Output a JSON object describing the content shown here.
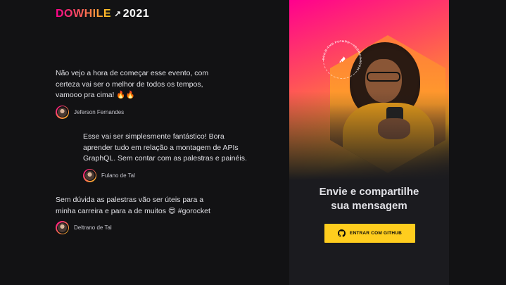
{
  "logo": {
    "do": "DOWHILE",
    "rocket": "↗",
    "year": "2021"
  },
  "messages": [
    {
      "text": "Não vejo a hora de começar esse evento, com certeza vai ser o melhor de todos os tempos, vamooo pra cima! 🔥🔥",
      "user": "Jeferson Fernandes"
    },
    {
      "text": "Esse vai ser simplesmente fantástico! Bora aprender tudo em relação a montagem de APIs GraphQL. Sem contar com as palestras e painéis.",
      "user": "Fulano de Tal"
    },
    {
      "text": "Sem dúvida as palestras vão ser úteis para a minha carreira e para a de muitos 😍 #gorocket",
      "user": "Deltrano de Tal"
    }
  ],
  "login": {
    "heading_line1": "Envie e compartilhe",
    "heading_line2": "sua mensagem",
    "button_label": "ENTRAR COM GITHUB",
    "badge_text": "BUILD THE FUTURE • #DOWHILE2021 •"
  },
  "colors": {
    "background": "#121214",
    "panel": "#1b1b1f",
    "accent_pink": "#ff008e",
    "accent_yellow": "#ffcd1e"
  },
  "icons": {
    "github": "github-icon",
    "rocket": "rocket-icon"
  }
}
